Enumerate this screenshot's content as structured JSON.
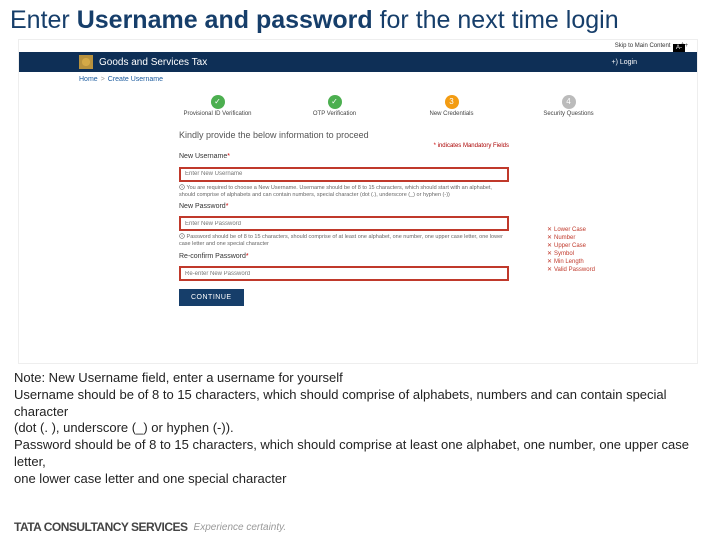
{
  "title_light1": "Enter ",
  "title_bold": "Username and password",
  "title_light2": " for the next time login",
  "topbar": {
    "skip": "Skip to Main Content",
    "a1": "A+",
    "a2": "A-"
  },
  "header": {
    "brand": "Goods and Services Tax",
    "login": "+) Login"
  },
  "breadcrumb": {
    "a": "Home",
    "sep": ">",
    "b": "Create Username"
  },
  "steps": {
    "s1": {
      "num": "✓",
      "label": "Provisional ID Verification"
    },
    "s2": {
      "num": "✓",
      "label": "OTP Verification"
    },
    "s3": {
      "num": "3",
      "label": "New Credentials"
    },
    "s4": {
      "num": "4",
      "label": "Security Questions"
    }
  },
  "form": {
    "heading": "Kindly provide the below information to proceed",
    "mandatory": "indicates Mandatory Fields",
    "u_label": "New Username",
    "u_ph": "Enter New Username",
    "u_hint": "You are required to choose a New Username. Username should be of 8 to 15 characters, which should start with an alphabet, should comprise of alphabets and can contain numbers, special character (dot (.), underscore (_) or hyphen (-))",
    "p_label": "New Password",
    "p_ph": "Enter New Password",
    "p_hint": "Password should be of 8 to 15 characters, should comprise of at least one alphabet, one number, one upper case letter, one lower case letter and one special character",
    "c_label": "Re-confirm Password",
    "c_ph": "Re-enter New Password",
    "btn": "CONTINUE"
  },
  "checklist": {
    "a": "Lower Case",
    "b": "Number",
    "c": "Upper Case",
    "d": "Symbol",
    "e": "Min Length",
    "f": "Valid Password"
  },
  "note": "Note: New Username field, enter a username for yourself\nUsername should be of 8 to 15 characters, which should comprise of alphabets, numbers and can contain special character\n(dot (. ), underscore (_) or hyphen (-)).\nPassword should be of 8 to 15 characters, which should comprise at least one alphabet, one number, one upper case letter,\none lower case letter and one special character",
  "tcs": {
    "brand": "TATA CONSULTANCY SERVICES",
    "tag": "Experience certainty."
  }
}
